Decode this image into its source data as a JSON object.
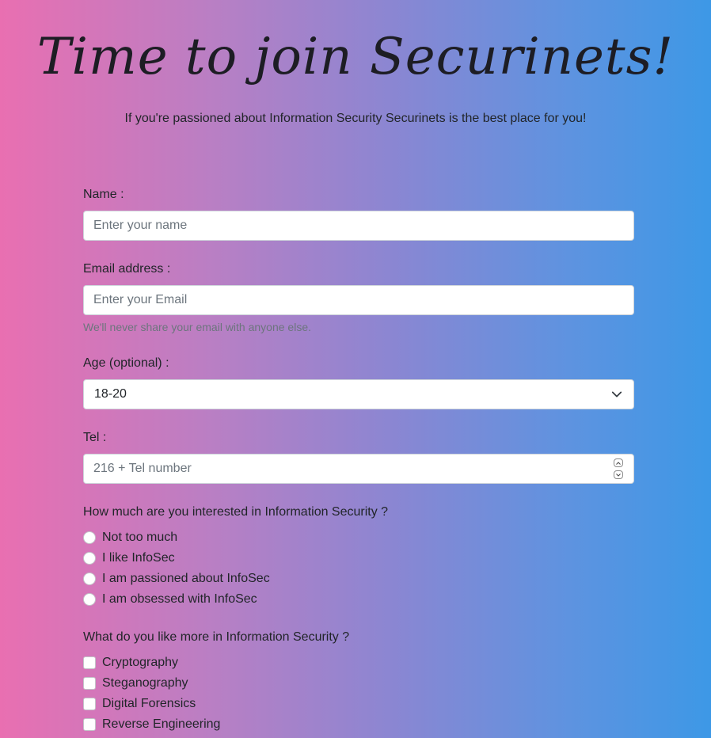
{
  "header": {
    "title": "Time to join Securinets!",
    "subtitle": "If you're passioned about Information Security Securinets is the best place for you!"
  },
  "form": {
    "name": {
      "label": "Name :",
      "placeholder": "Enter your name",
      "value": ""
    },
    "email": {
      "label": "Email address :",
      "placeholder": "Enter your Email",
      "value": "",
      "help": "We'll never share your email with anyone else."
    },
    "age": {
      "label": "Age (optional) :",
      "selected": "18-20",
      "icon": "chevron-down-icon"
    },
    "tel": {
      "label": "Tel :",
      "placeholder": "216 + Tel number",
      "value": ""
    },
    "interest": {
      "question": "How much are you interested in Information Security ?",
      "options": [
        "Not too much",
        "I like InfoSec",
        "I am passioned about InfoSec",
        "I am obsessed with InfoSec"
      ]
    },
    "likes": {
      "question": "What do you like more in Information Security ?",
      "options": [
        "Cryptography",
        "Steganography",
        "Digital Forensics",
        "Reverse Engineering"
      ]
    }
  },
  "colors": {
    "gradient_left": "#e96fb1",
    "gradient_right": "#3d98e6",
    "text": "#212529",
    "muted": "#6c757d",
    "input_border": "#ced4da"
  }
}
